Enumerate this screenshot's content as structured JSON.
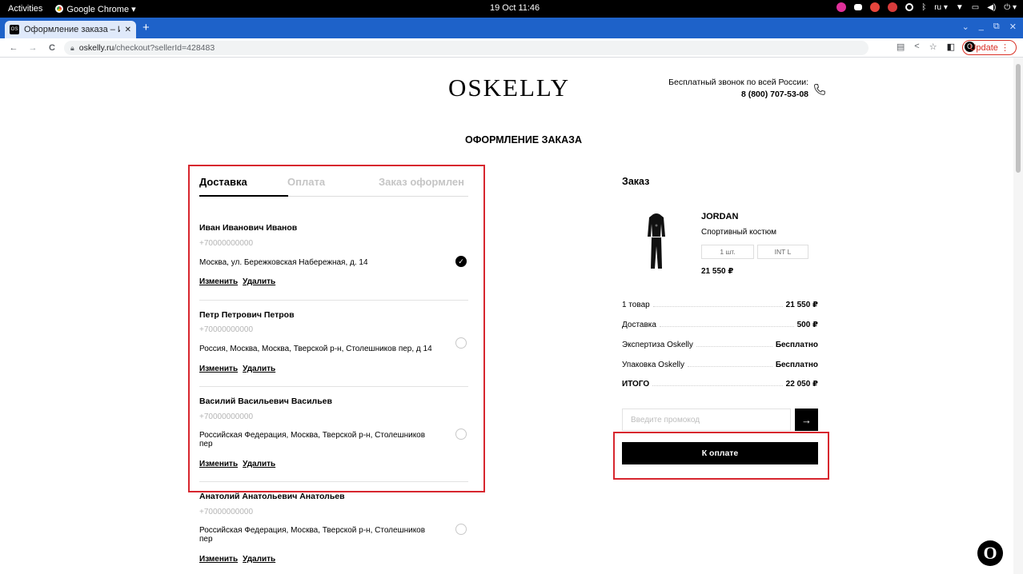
{
  "os": {
    "activities": "Activities",
    "app_name": "Google Chrome ▾",
    "clock": "19 Oct  11:46",
    "lang": "ru ▾"
  },
  "browser": {
    "tab_title": "Оформление заказа – И",
    "tab_favicon": "OS",
    "url_host": "oskelly.ru",
    "url_path": "/checkout?sellerId=428483",
    "update_label": "Update",
    "icons": [
      "back-icon",
      "forward-icon",
      "reload-icon",
      "lock-icon",
      "translate-icon",
      "share-icon",
      "star-icon",
      "sidepanel-icon",
      "oskelly-ext-icon"
    ]
  },
  "header": {
    "logo": "OSKELLY",
    "call_label": "Бесплатный звонок по всей России:",
    "call_phone": "8 (800) 707-53-08"
  },
  "page_title": "ОФОРМЛЕНИЕ ЗАКАЗА",
  "steps": [
    {
      "label": "Доставка",
      "active": true
    },
    {
      "label": "Оплата",
      "active": false
    },
    {
      "label": "Заказ оформлен",
      "active": false
    }
  ],
  "addresses": [
    {
      "name": "Иван Иванович Иванов",
      "phone": "+70000000000",
      "address": "Москва, ул. Бережковская Набережная, д. 14",
      "selected": true
    },
    {
      "name": "Петр Петрович Петров",
      "phone": "+70000000000",
      "address": "Россия, Москва, Москва, Тверской р-н, Столешников пер, д 14",
      "selected": false
    },
    {
      "name": "Василий Васильевич Васильев",
      "phone": "+70000000000",
      "address": "Российская Федерация, Москва, Тверской р-н, Столешников пер",
      "selected": false
    },
    {
      "name": "Анатолий Анатольевич Анатольев",
      "phone": "+70000000000",
      "address": "Российская Федерация, Москва, Тверской р-н, Столешников пер",
      "selected": false
    }
  ],
  "address_actions": {
    "edit": "Изменить",
    "delete": "Удалить"
  },
  "order": {
    "title": "Заказ",
    "product": {
      "brand": "JORDAN",
      "type": "Спортивный костюм",
      "qty": "1 шт.",
      "size": "INT L",
      "price": "21 550 ₽"
    },
    "summary": [
      {
        "label": "1 товар",
        "value": "21 550 ₽"
      },
      {
        "label": "Доставка",
        "value": "500 ₽"
      },
      {
        "label": "Экспертиза Oskelly",
        "value": "Бесплатно"
      },
      {
        "label": "Упаковка Oskelly",
        "value": "Бесплатно"
      },
      {
        "label": "ИТОГО",
        "value": "22 050 ₽"
      }
    ],
    "promo_placeholder": "Введите промокод",
    "pay_label": "К оплате"
  },
  "chat_logo": "O",
  "colors": {
    "highlight": "#d7262e",
    "chrome_blue": "#1e62c9",
    "accent": "#000000"
  }
}
